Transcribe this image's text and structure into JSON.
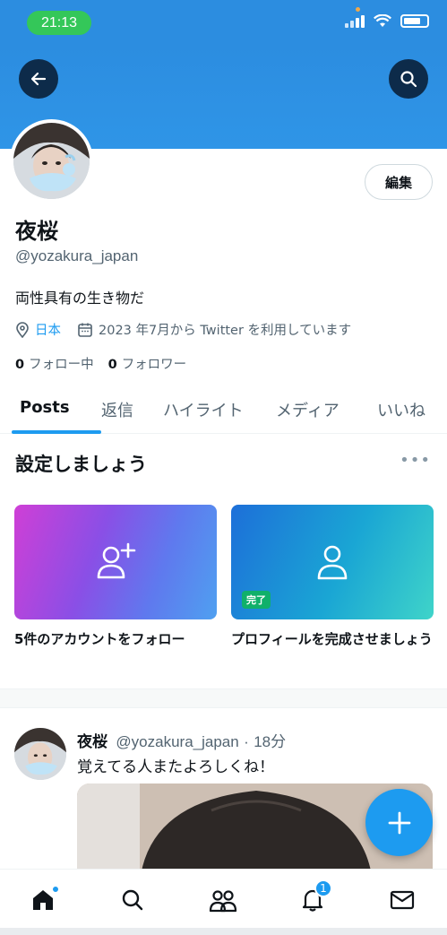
{
  "status_bar": {
    "time": "21:13"
  },
  "profile": {
    "display_name": "夜桜",
    "handle": "@yozakura_japan",
    "bio": "両性具有の生き物だ",
    "location": "日本",
    "joined": "2023 年7月から Twitter を利用しています",
    "following_count": "0",
    "following_label": "フォロー中",
    "followers_count": "0",
    "followers_label": "フォロワー",
    "edit_label": "編集"
  },
  "tabs": [
    {
      "label": "Posts"
    },
    {
      "label": "返信"
    },
    {
      "label": "ハイライト"
    },
    {
      "label": "メディア"
    },
    {
      "label": "いいね"
    }
  ],
  "setup": {
    "title": "設定しましょう",
    "cards": [
      {
        "label": "5件のアカウントをフォロー",
        "icon": "add-person-icon"
      },
      {
        "label": "プロフィールを完成させましょう",
        "icon": "person-icon",
        "badge": "完了"
      }
    ]
  },
  "post": {
    "author": "夜桜",
    "handle": "@yozakura_japan",
    "separator": "·",
    "time": "18分",
    "text": "覚えてる人またよろしくね！"
  },
  "bottom_nav": {
    "items": [
      "home-icon",
      "search-icon",
      "communities-icon",
      "notifications-icon",
      "messages-icon"
    ],
    "notification_count": "1"
  },
  "colors": {
    "accent": "#1d9bf0",
    "banner": "#2c8de0",
    "done_badge": "#10b06a"
  }
}
